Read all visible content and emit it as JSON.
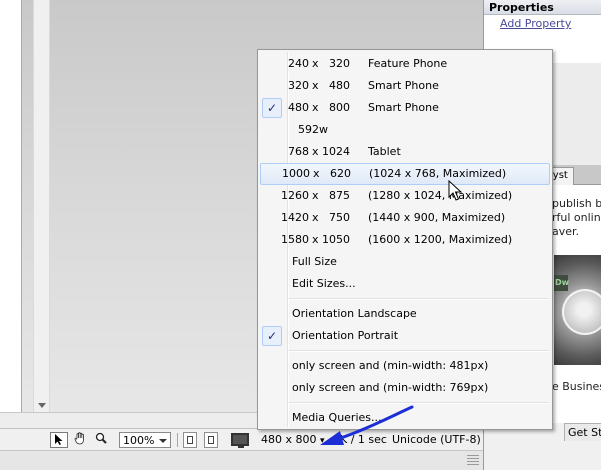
{
  "properties_panel": {
    "title": "Properties",
    "add_property": "Add Property"
  },
  "right_panel": {
    "tab_label": "lyst",
    "lines": [
      "publish b",
      "rful onlin",
      "aver."
    ],
    "logo_text": "Dw",
    "business_text": "e Busines",
    "get_started": "Get Sta"
  },
  "status_bar": {
    "zoom": "100%",
    "window_size": "480 x 800",
    "download": "K / 1 sec",
    "encoding": "Unicode (UTF-8)"
  },
  "menu": {
    "sizes": [
      {
        "w": "240",
        "h": "320",
        "label": "Feature Phone",
        "checked": false
      },
      {
        "w": "320",
        "h": "480",
        "label": "Smart Phone",
        "checked": false
      },
      {
        "w": "480",
        "h": "800",
        "label": "Smart Phone",
        "checked": true
      },
      {
        "label": "592w"
      },
      {
        "w": "768",
        "h": "1024",
        "label": "Tablet",
        "checked": false
      },
      {
        "w": "1000",
        "h": "620",
        "label": "(1024 x 768, Maximized)",
        "checked": false,
        "highlighted": true
      },
      {
        "w": "1260",
        "h": "875",
        "label": "(1280 x 1024, Maximized)"
      },
      {
        "w": "1420",
        "h": "750",
        "label": "(1440 x 900, Maximized)"
      },
      {
        "w": "1580",
        "h": "1050",
        "label": "(1600 x 1200, Maximized)"
      }
    ],
    "x_sep": "x",
    "full_size": "Full Size",
    "edit_sizes": "Edit Sizes...",
    "orientation_landscape": "Orientation Landscape",
    "orientation_portrait": "Orientation Portrait",
    "orientation_portrait_checked": true,
    "media_1": "only screen and (min-width: 481px)",
    "media_2": "only screen and (min-width: 769px)",
    "media_queries": "Media Queries...",
    "check_glyph": "✓"
  },
  "colors": {
    "menu_highlight_border": "#aecef7",
    "check_color": "#1f2d7a",
    "annotation_arrow": "#1c2fd6"
  },
  "icons": {
    "pointer": "select-pointer-icon",
    "hand": "hand-tool-icon",
    "zoom": "zoom-tool-icon",
    "monitor": "monitor-icon",
    "cursor": "mouse-cursor-icon"
  }
}
